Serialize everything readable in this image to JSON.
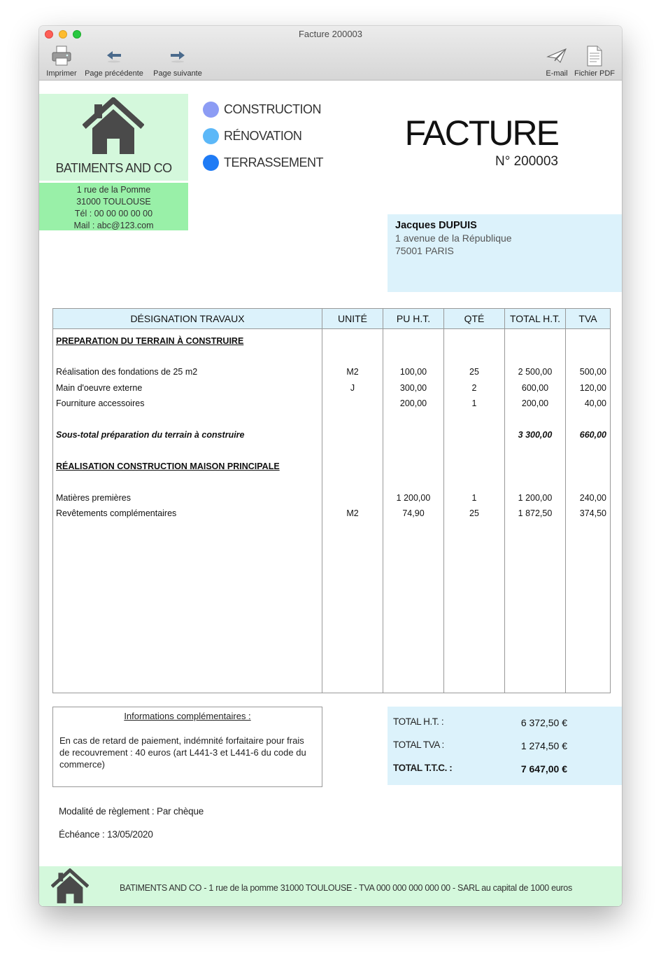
{
  "window": {
    "title": "Facture 200003"
  },
  "toolbar": {
    "print": "Imprimer",
    "prev": "Page précédente",
    "next": "Page suivante",
    "email": "E-mail",
    "pdf": "Fichier PDF"
  },
  "company": {
    "name": "BATIMENTS AND CO",
    "address1": "1 rue de la Pomme",
    "address2": "31000 TOULOUSE",
    "phone": "Tél : 00 00 00 00 00",
    "mail": "Mail : abc@123.com"
  },
  "services": [
    {
      "label": "CONSTRUCTION",
      "color": "#8c9cf4"
    },
    {
      "label": "RÉNOVATION",
      "color": "#5cb8f8"
    },
    {
      "label": "TERRASSEMENT",
      "color": "#1f7bf5"
    }
  ],
  "invoice": {
    "title": "FACTURE",
    "number": "N° 200003"
  },
  "client": {
    "name": "Jacques DUPUIS",
    "address1": "1 avenue de la République",
    "address2": "75001 PARIS"
  },
  "table": {
    "headers": {
      "designation": "DÉSIGNATION TRAVAUX",
      "unit": "UNITÉ",
      "pu": "PU H.T.",
      "qty": "QTÉ",
      "total": "TOTAL H.T.",
      "tva": "TVA"
    },
    "rows": [
      {
        "type": "section",
        "designation": "PREPARATION DU TERRAIN À CONSTRUIRE"
      },
      {
        "type": "item",
        "designation": "Réalisation des fondations de 25 m2",
        "unit": "M2",
        "pu": "100,00",
        "qty": "25",
        "total": "2 500,00",
        "tva": "500,00"
      },
      {
        "type": "item",
        "designation": "Main d'oeuvre externe",
        "unit": "J",
        "pu": "300,00",
        "qty": "2",
        "total": "600,00",
        "tva": "120,00"
      },
      {
        "type": "item",
        "designation": "Fourniture accessoires",
        "unit": "",
        "pu": "200,00",
        "qty": "1",
        "total": "200,00",
        "tva": "40,00"
      },
      {
        "type": "subtotal",
        "designation": "Sous-total préparation du terrain à construire",
        "total": "3 300,00",
        "tva": "660,00"
      },
      {
        "type": "section",
        "designation": "RÉALISATION CONSTRUCTION MAISON PRINCIPALE"
      },
      {
        "type": "item",
        "designation": "Matières premières",
        "unit": "",
        "pu": "1 200,00",
        "qty": "1",
        "total": "1 200,00",
        "tva": "240,00"
      },
      {
        "type": "item",
        "designation": "Revêtements complémentaires",
        "unit": "M2",
        "pu": "74,90",
        "qty": "25",
        "total": "1 872,50",
        "tva": "374,50"
      }
    ]
  },
  "info": {
    "title": "Informations complémentaires :",
    "text": "En cas de retard de paiement, indémnité forfaitaire pour frais de recouvrement : 40 euros (art L441-3 et L441-6 du code du commerce)"
  },
  "totals": {
    "ht_label": "TOTAL H.T.   :",
    "ht_value": "6 372,50 €",
    "tva_label": "TOTAL TVA   :",
    "tva_value": "1 274,50 €",
    "ttc_label": "TOTAL T.T.C. :",
    "ttc_value": "7 647,00 €"
  },
  "payment": {
    "method": "Modalité de règlement : Par chèque",
    "due": "Échéance : 13/05/2020"
  },
  "footer": {
    "text": "BATIMENTS AND CO - 1 rue de la pomme 31000 TOULOUSE - TVA 000 000 000 000 00 - SARL au capital de 1000 euros"
  },
  "icons": [
    "printer-icon",
    "arrow-left-icon",
    "arrow-right-icon",
    "paper-plane-icon",
    "pdf-file-icon",
    "house-icon"
  ]
}
